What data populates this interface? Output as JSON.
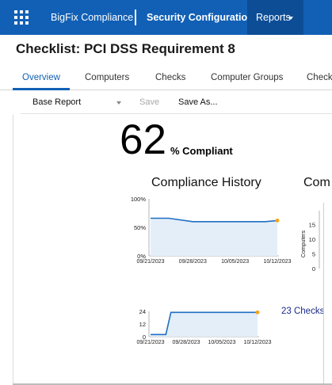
{
  "topbar": {
    "apps_icon": "grid-icon",
    "brand": "BigFix Compliance",
    "app_title": "Security Configuration",
    "reports_label": "Reports"
  },
  "page": {
    "title": "Checklist: PCI DSS Requirement 8"
  },
  "tabs": [
    {
      "label": "Overview",
      "active": true
    },
    {
      "label": "Computers",
      "active": false
    },
    {
      "label": "Checks",
      "active": false
    },
    {
      "label": "Computer Groups",
      "active": false
    },
    {
      "label": "Check",
      "active": false
    }
  ],
  "toolbar": {
    "report_select_value": "Base Report",
    "save_label": "Save",
    "save_as_label": "Save As..."
  },
  "compliance": {
    "percent": "62",
    "suffix": "% Compliant"
  },
  "sections": {
    "history_title": "Compliance History",
    "second_title_partial": "Com"
  },
  "colors": {
    "brand_blue": "#1160b6",
    "reports_bg": "#0c4d96",
    "line": "#1f6fc2",
    "area_fill": "#e3eef9",
    "end_marker": "#f2a31a",
    "link": "#1a2a8a"
  },
  "chart_data": [
    {
      "type": "area",
      "title": "Compliance History",
      "x": [
        "09/21/2023",
        "09/24/2023",
        "09/28/2023",
        "10/05/2023",
        "10/10/2023",
        "10/12/2023"
      ],
      "series": [
        {
          "values": [
            66,
            66,
            60,
            60,
            60,
            62
          ]
        }
      ],
      "x_ticks": [
        "09/21/2023",
        "09/28/2023",
        "10/05/2023",
        "10/12/2023"
      ],
      "y_ticks": [
        "100%",
        "50%",
        "0%"
      ],
      "ylim": [
        0,
        100
      ],
      "grid": false
    },
    {
      "type": "area",
      "x": [
        "09/21/2023",
        "09/24/2023",
        "09/25/2023",
        "10/12/2023"
      ],
      "series": [
        {
          "values": [
            2,
            2,
            23,
            23
          ]
        }
      ],
      "x_ticks": [
        "09/21/2023",
        "09/28/2023",
        "10/05/2023",
        "10/12/2023"
      ],
      "y_ticks": [
        "24",
        "12",
        "0"
      ],
      "ylim": [
        0,
        24
      ],
      "annotation": "23 Checks",
      "grid": false
    },
    {
      "type": "area",
      "ylabel": "Computers",
      "y_ticks": [
        "15",
        "10",
        "5",
        "0"
      ],
      "ylim": [
        0,
        17
      ]
    }
  ]
}
